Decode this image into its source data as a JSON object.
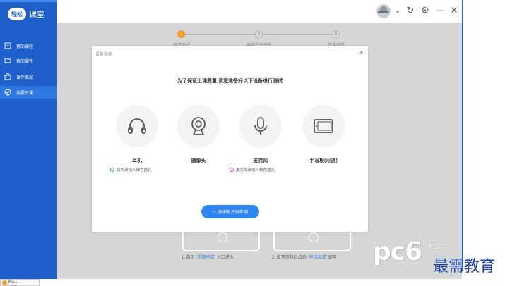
{
  "app": {
    "logo_badge": "轻松",
    "logo_text": "课堂"
  },
  "sidebar": {
    "items": [
      {
        "label": "我的课程",
        "icon": "square-icon",
        "active": false
      },
      {
        "label": "我的课件",
        "icon": "folder-icon",
        "active": false
      },
      {
        "label": "课件商城",
        "icon": "shopping-bag-icon",
        "active": false
      },
      {
        "label": "我要开课",
        "icon": "check-circle-icon",
        "active": true
      }
    ]
  },
  "topbar": {
    "dropdown_glyph": "⌄",
    "refresh_glyph": "↻",
    "settings_glyph": "⚙",
    "minimize_glyph": "—",
    "close_glyph": "✕"
  },
  "steps": [
    {
      "num": "1",
      "label": "申请面试",
      "active": true
    },
    {
      "num": "2",
      "label": "能网三现审核",
      "active": false
    },
    {
      "num": "3",
      "label": "开课审核",
      "active": false
    }
  ],
  "background": {
    "caption_left_pre": "1. 首页 “",
    "caption_left_hl": "提现申请",
    "caption_left_post": "” 入口进入",
    "caption_right_pre": "2. 填写资料后点击 “",
    "caption_right_hl": "申请面试",
    "caption_right_post": "” 即可"
  },
  "modal": {
    "title": "设备检测",
    "close_glyph": "×",
    "heading": "为了保证上课质量,请您准备好以下设备进行测试",
    "devices": [
      {
        "name": "耳机",
        "icon": "headphones-icon",
        "note": "耳机请插入绿色插孔",
        "note_color": "green"
      },
      {
        "name": "摄像头",
        "icon": "webcam-icon",
        "note": "",
        "note_color": ""
      },
      {
        "name": "麦克风",
        "icon": "microphone-icon",
        "note": "麦克风请插入粉色插孔",
        "note_color": "pink"
      },
      {
        "name": "手写板(可选)",
        "icon": "tablet-icon",
        "note": "",
        "note_color": ""
      }
    ],
    "start_button": "一切就绪 开始检测"
  },
  "watermark": {
    "pc_text": "pc6",
    "download_text": "下载站",
    "edu_text": "最需教育"
  },
  "taskbar": {
    "label": "Ru..."
  },
  "colors": {
    "sidebar": "#1f5fc9",
    "sidebar_active": "#2f78e0",
    "primary_button": "#2f86f0",
    "step_active": "#f39a2a",
    "green_port": "#2fb14a",
    "pink_port": "#d63ea8"
  }
}
